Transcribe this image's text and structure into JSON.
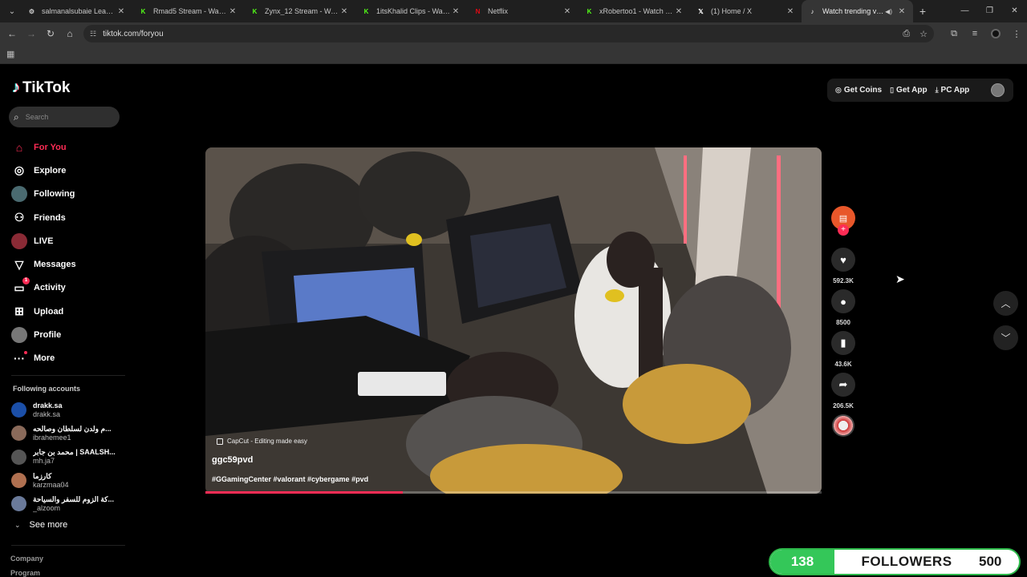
{
  "browser": {
    "tabs": [
      {
        "title": "salmanalsubaie LeaderBo",
        "favicon": "gear-icon",
        "favcolor": "#cccccc"
      },
      {
        "title": "Rmad5 Stream - Watch L",
        "favicon": "kick-icon",
        "favcolor": "#53fc18"
      },
      {
        "title": "Zynx_12 Stream - Watch",
        "favicon": "kick-icon",
        "favcolor": "#53fc18"
      },
      {
        "title": "1itsKhalid Clips - Watch L",
        "favicon": "kick-icon",
        "favcolor": "#53fc18"
      },
      {
        "title": "Netflix",
        "favicon": "netflix-icon",
        "favcolor": "#e50914"
      },
      {
        "title": "xRobertoo1 - Watch the V",
        "favicon": "kick-icon",
        "favcolor": "#53fc18"
      },
      {
        "title": "(1) Home / X",
        "favicon": "x-icon",
        "favcolor": "#ffffff"
      },
      {
        "title": "Watch trending video",
        "favicon": "tiktok-icon",
        "favcolor": "#ffffff",
        "active": true
      }
    ],
    "url": "tiktok.com/foryou"
  },
  "sidebar": {
    "logo": "TikTok",
    "search_placeholder": "Search",
    "nav": [
      {
        "label": "For You",
        "icon": "home-icon",
        "active": true
      },
      {
        "label": "Explore",
        "icon": "compass-icon"
      },
      {
        "label": "Following",
        "icon": "following-avatar-icon"
      },
      {
        "label": "Friends",
        "icon": "friends-icon"
      },
      {
        "label": "LIVE",
        "icon": "live-icon"
      },
      {
        "label": "Messages",
        "icon": "messages-icon"
      },
      {
        "label": "Activity",
        "icon": "activity-icon",
        "badge": "1"
      },
      {
        "label": "Upload",
        "icon": "upload-icon"
      },
      {
        "label": "Profile",
        "icon": "profile-icon"
      },
      {
        "label": "More",
        "icon": "more-icon"
      }
    ],
    "following_title": "Following accounts",
    "accounts": [
      {
        "name": "drakk.sa",
        "handle": "drakk.sa",
        "color": "#1b4fa8"
      },
      {
        "name": "م ولدن لسلطان وصالحه...",
        "handle": "ibrahemee1",
        "color": "#8a6a5a"
      },
      {
        "name": "محمد بن جابر | SAALSH...",
        "handle": "mh.ja7",
        "color": "#555555"
      },
      {
        "name": "كارزما",
        "handle": "karzmaa04",
        "color": "#b07050"
      },
      {
        "name": "كة الزوم للسفر والسياحة...",
        "handle": "_alzoom",
        "color": "#6a7a9a"
      }
    ],
    "see_more": "See more",
    "footer": [
      "Company",
      "Program"
    ]
  },
  "topbar": {
    "get_coins": "Get Coins",
    "get_app": "Get App",
    "pc_app": "PC App"
  },
  "video": {
    "watermark": "CapCut - Editing made easy",
    "author": "ggc59pvd",
    "description": "#GGamingCenter #valorant #cybergame #pvd",
    "progress": 0.32,
    "likes": "592.3K",
    "comments": "8500",
    "saves": "43.6K",
    "shares": "206.5K"
  },
  "overlay": {
    "current": "138",
    "label": "FOLLOWERS",
    "goal": "500"
  }
}
